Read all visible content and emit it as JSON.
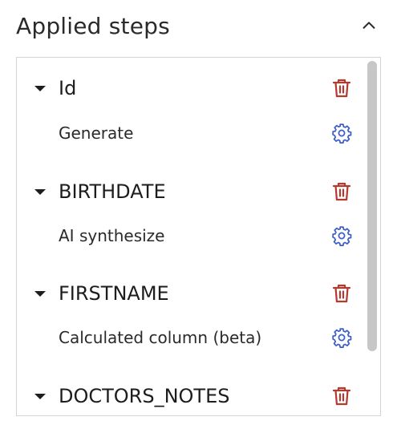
{
  "header": {
    "title": "Applied steps",
    "collapse_icon": "chevron-up-icon"
  },
  "colors": {
    "delete": "#b33a2e",
    "settings": "#3c5ec7",
    "scroll_thumb": "#c7c7c7"
  },
  "steps": [
    {
      "column": "Id",
      "transform": "Generate"
    },
    {
      "column": "BIRTHDATE",
      "transform": "AI synthesize"
    },
    {
      "column": "FIRSTNAME",
      "transform": "Calculated column (beta)"
    },
    {
      "column": "DOCTORS_NOTES",
      "transform": ""
    }
  ],
  "icons": {
    "expand": "caret-down-icon",
    "delete": "trash-icon",
    "settings": "gear-icon"
  }
}
